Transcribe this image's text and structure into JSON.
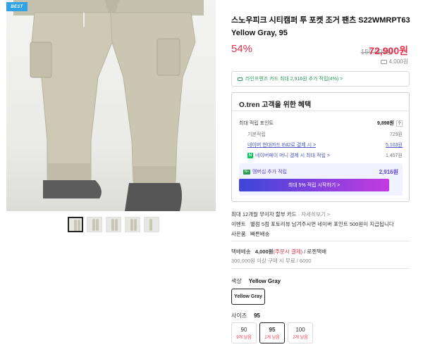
{
  "image": {
    "badge": "BEST",
    "thumbnail_count": 5
  },
  "product": {
    "title": "스노우피크 시티캠퍼 투 포켓 조거 팬츠 S22WMRPT63 Yellow Gray, 95",
    "discount": "54%",
    "original_price": "159,000원",
    "sale_price": "72,900원",
    "shipping_fee": "4,000원"
  },
  "card_banner": "라인프렌즈 카드 최대 2,916원 추가 적립(4%) >",
  "benefit": {
    "heading": "O.tren 고객을 위한 혜택",
    "total_label": "최대 적립 포인트",
    "total_value": "9,898원",
    "help": "?",
    "basic_label": "기본적립",
    "basic_value": "729원",
    "hyundai_label": "네이버 현대카드 Ed2로 결제 시 >",
    "hyundai_value": "5,103원",
    "naver_icon": "N",
    "naver_label": "네이버페이 머니 결제 시 최대 적립 >",
    "naver_value": "1,457원",
    "member_icon": "N+",
    "member_label": "멤버십 추가 적립",
    "member_value": "2,916원",
    "member_button": "최대 5% 적립 시작하기 >"
  },
  "info": {
    "card_label": "최대 12개월 무이자 할부 카드",
    "card_link": "자세히보기",
    "event_label": "이벤트",
    "event_text": "별점 5점 포토리뷰 남겨주시면 네이버 포인트 500원이 지급됩니다",
    "gift_label": "사은품",
    "gift_text": "빠른배송",
    "ship_label": "택배배송",
    "ship_fee": "4,000원",
    "ship_note": "(주문시 결제)",
    "ship_carrier": " / 로젠택배",
    "free_ship": "300,000원 이상 구매 시 무료 / 6000"
  },
  "options": {
    "color_label": "색상",
    "color_value": "Yellow Gray",
    "color_button": "Yellow Gray",
    "size_label": "사이즈",
    "size_value": "95",
    "sizes": [
      {
        "size": "90",
        "stock": "9개 남음"
      },
      {
        "size": "95",
        "stock": "1개 남음"
      },
      {
        "size": "100",
        "stock": "2개 남음"
      }
    ]
  }
}
